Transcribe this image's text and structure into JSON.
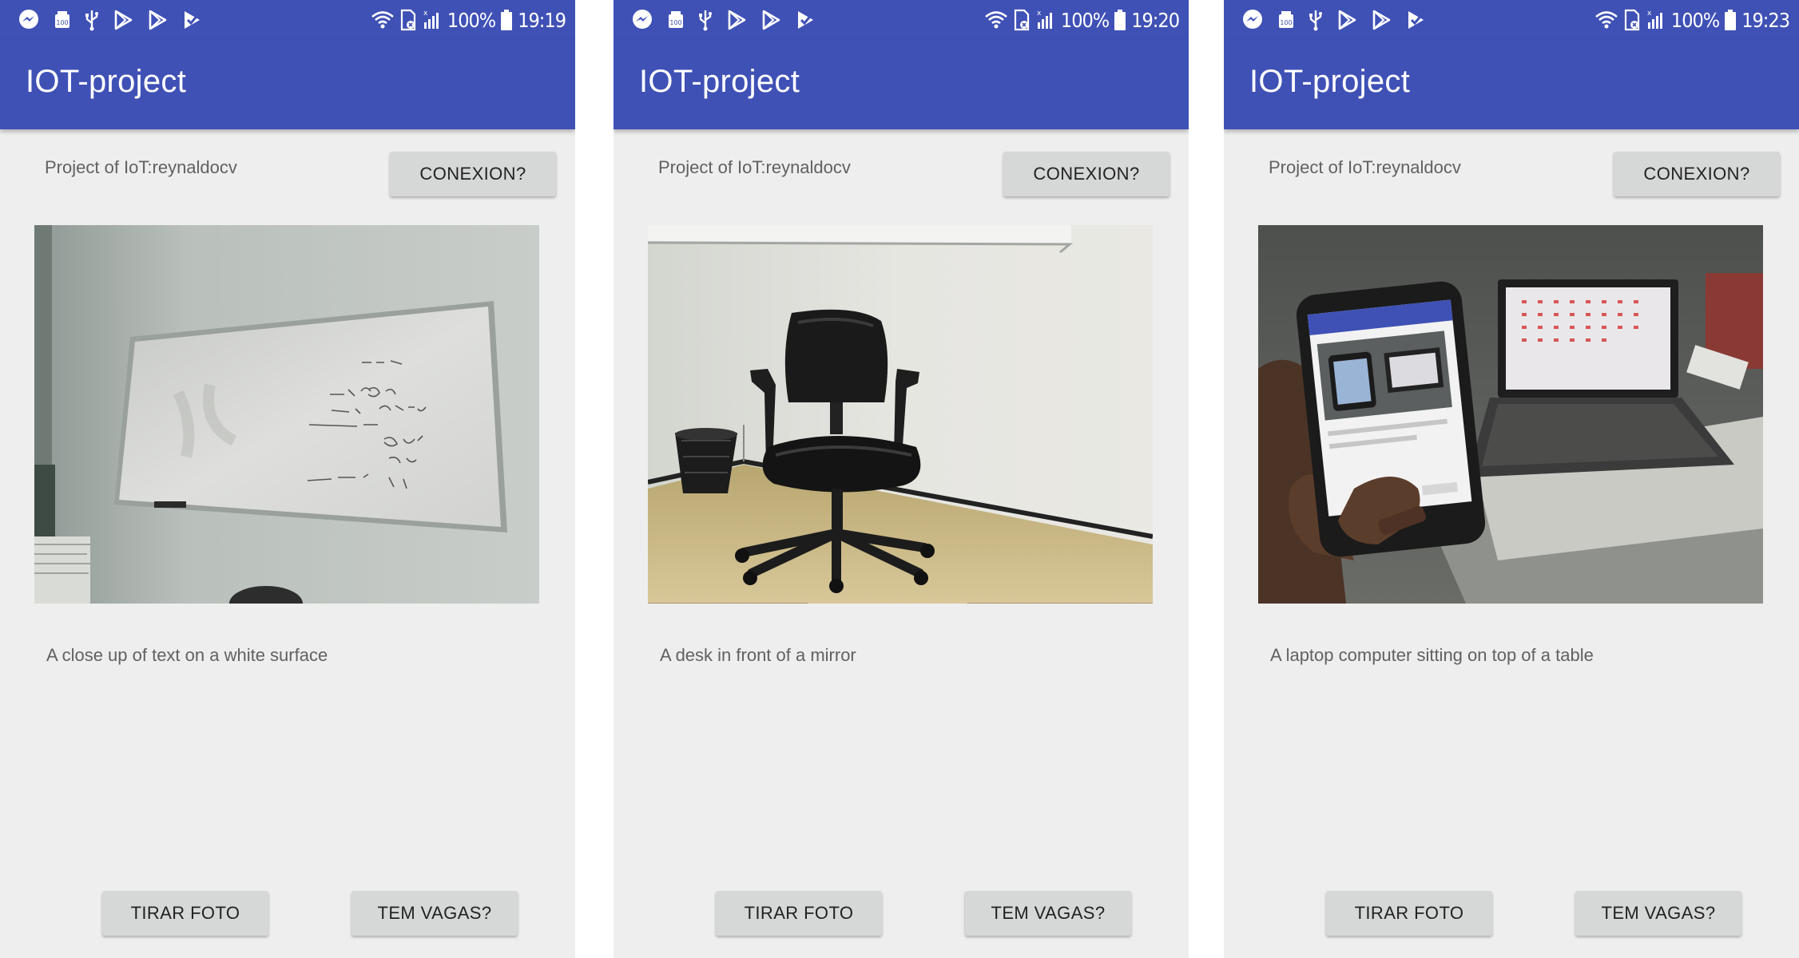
{
  "screens": [
    {
      "status": {
        "battery_text": "100%",
        "time": "19:19"
      },
      "app_title": "IOT-project",
      "project_label": "Project of IoT:reynaldocv",
      "connection_button": "CONEXION?",
      "photo_subject": "whiteboard",
      "caption": "A close up of text on a white surface",
      "take_photo_button": "TIRAR FOTO",
      "vacancy_button": "TEM VAGAS?"
    },
    {
      "status": {
        "battery_text": "100%",
        "time": "19:20"
      },
      "app_title": "IOT-project",
      "project_label": "Project of IoT:reynaldocv",
      "connection_button": "CONEXION?",
      "photo_subject": "office chair",
      "caption": "A desk in front of a mirror",
      "take_photo_button": "TIRAR FOTO",
      "vacancy_button": "TEM VAGAS?"
    },
    {
      "status": {
        "battery_text": "100%",
        "time": "19:23"
      },
      "app_title": "IOT-project",
      "project_label": "Project of IoT:reynaldocv",
      "connection_button": "CONEXION?",
      "photo_subject": "phone and laptop",
      "caption": "A laptop computer sitting on top of a table",
      "take_photo_button": "TIRAR FOTO",
      "vacancy_button": "TEM VAGAS?"
    }
  ],
  "status_icons": [
    "messenger-icon",
    "storage-icon",
    "usb-icon",
    "play-store-icon",
    "play-store-icon",
    "play-check-icon",
    "wifi-icon",
    "sim-icon",
    "signal-icon",
    "battery-icon"
  ],
  "colors": {
    "primary": "#3f51b5",
    "background": "#eeeeee",
    "button": "#d6d7d7"
  }
}
